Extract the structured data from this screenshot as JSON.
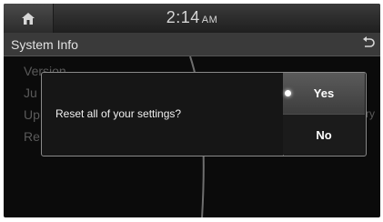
{
  "status_bar": {
    "home_icon": "home-icon",
    "time": "2:14",
    "ampm": "AM"
  },
  "header": {
    "title": "System Info",
    "back_icon": "back-arrow-icon"
  },
  "background_items": [
    {
      "label": "Version"
    },
    {
      "label": "Ju"
    },
    {
      "label": "Up"
    },
    {
      "label": "Re"
    }
  ],
  "background_right_fragment": "ry",
  "dialog": {
    "message": "Reset all of your settings?",
    "yes_label": "Yes",
    "no_label": "No",
    "selected": "Yes"
  },
  "colors": {
    "screen_bg": "#0b0b0b",
    "titlebar_bg": "#3a3a3a",
    "dialog_border": "#8a8a8a"
  }
}
